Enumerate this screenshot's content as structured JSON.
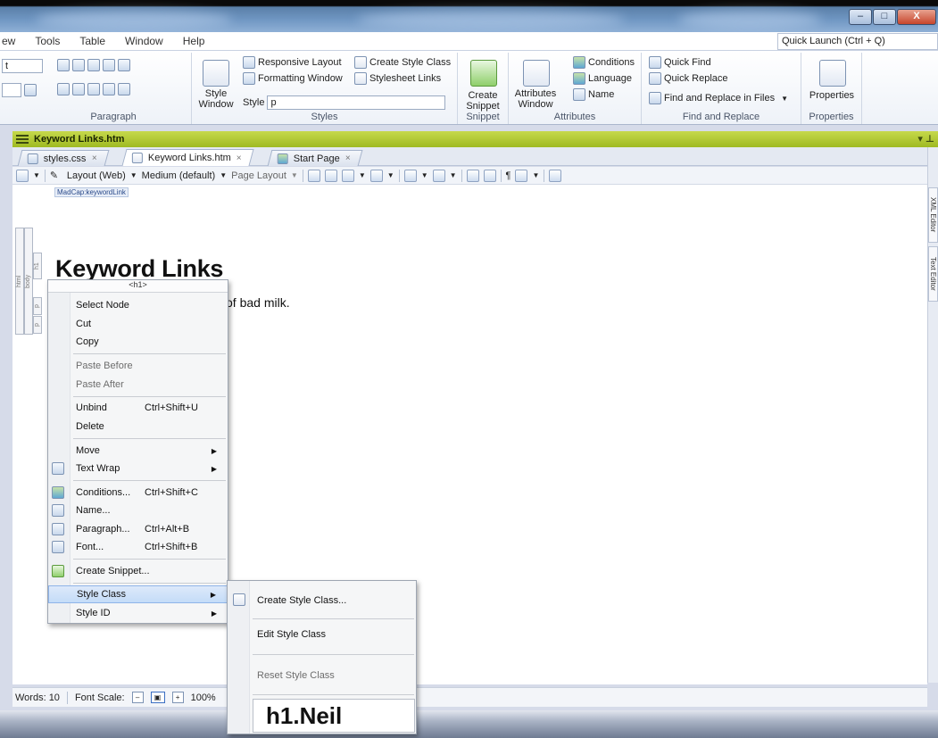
{
  "window": {
    "controls": [
      "–",
      "□",
      "X"
    ]
  },
  "menubar": {
    "items": [
      "ew",
      "Tools",
      "Table",
      "Window",
      "Help"
    ]
  },
  "quick_launch": {
    "value": "Quick Launch (Ctrl + Q)"
  },
  "ribbon": {
    "paragraph": {
      "label": "Paragraph",
      "dropdown_left": "t",
      "expander": "⊡"
    },
    "styles": {
      "label": "Styles",
      "style_window_label": "Style Window",
      "responsive_layout": "Responsive Layout",
      "create_style_class": "Create Style Class",
      "formatting_window": "Formatting Window",
      "stylesheet_links": "Stylesheet Links",
      "style_field_label": "Style",
      "style_field_value": "p"
    },
    "snippet": {
      "label": "Snippet",
      "create_snippet": "Create Snippet"
    },
    "attributes": {
      "label": "Attributes",
      "attributes_window": "Attributes Window",
      "conditions": "Conditions",
      "language": "Language",
      "name": "Name"
    },
    "find_replace": {
      "label": "Find and Replace",
      "quick_find": "Quick Find",
      "quick_replace": "Quick Replace",
      "find_replace_files": "Find and Replace in Files"
    },
    "properties": {
      "label": "Properties",
      "button": "Properties"
    }
  },
  "document": {
    "title": "Keyword Links.htm",
    "tabs": [
      {
        "label": "styles.css",
        "close": "×"
      },
      {
        "label": "Keyword Links.htm",
        "close": "×"
      },
      {
        "label": "Start Page",
        "close": "×"
      }
    ],
    "toolbar": {
      "layout": "Layout (Web)",
      "medium": "Medium (default)",
      "page_layout": "Page Layout",
      "pilcrow": "¶"
    },
    "breadcrumb": "MadCap:keywordLink",
    "structure_bars": [
      "html",
      "body",
      "h1",
      "p",
      "p"
    ],
    "heading": "Keyword Links",
    "paragraph_tail": "of bad milk.",
    "side_tabs": [
      "XML Editor",
      "Text Editor"
    ]
  },
  "status": {
    "words": "Words: 10",
    "font_scale_label": "Font Scale:",
    "font_scale_value": "100%"
  },
  "context_menu": {
    "header": "<h1>",
    "items": [
      {
        "label": "Select Node",
        "shortcut": ""
      },
      {
        "label": "Cut",
        "shortcut": ""
      },
      {
        "label": "Copy",
        "shortcut": ""
      },
      {
        "label": "Paste Before",
        "shortcut": "",
        "disabled": true
      },
      {
        "label": "Paste After",
        "shortcut": "",
        "disabled": true
      },
      {
        "label": "Unbind",
        "shortcut": "Ctrl+Shift+U"
      },
      {
        "label": "Delete",
        "shortcut": ""
      },
      {
        "label": "Move",
        "shortcut": ""
      },
      {
        "label": "Text Wrap",
        "shortcut": ""
      },
      {
        "label": "Conditions...",
        "shortcut": "Ctrl+Shift+C"
      },
      {
        "label": "Name...",
        "shortcut": ""
      },
      {
        "label": "Paragraph...",
        "shortcut": "Ctrl+Alt+B"
      },
      {
        "label": "Font...",
        "shortcut": "Ctrl+Shift+B"
      },
      {
        "label": "Create Snippet...",
        "shortcut": ""
      },
      {
        "label": "Style Class",
        "shortcut": ""
      },
      {
        "label": "Style ID",
        "shortcut": ""
      }
    ]
  },
  "submenu": {
    "items": [
      "Create Style Class...",
      "Edit Style Class",
      "Reset Style Class"
    ],
    "preview": "h1.Neil"
  }
}
